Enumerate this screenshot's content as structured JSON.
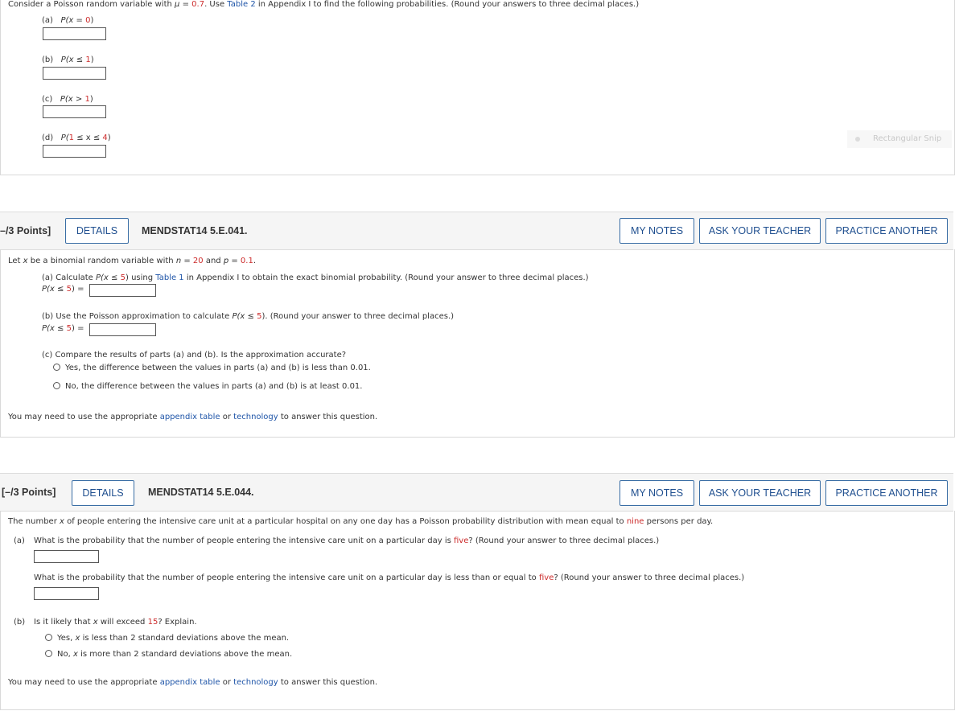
{
  "q1": {
    "intro": [
      "Consider a Poisson random variable with ",
      "μ",
      " = ",
      "0.7",
      ". Use ",
      "Table 2",
      " in Appendix I to find the following probabilities. (Round your answers to three decimal places.)"
    ],
    "parts": [
      {
        "tag": "(a)",
        "expr": [
          "P(x",
          " = ",
          "0",
          ")"
        ]
      },
      {
        "tag": "(b)",
        "expr": [
          "P(x",
          " ≤ ",
          "1",
          ")"
        ]
      },
      {
        "tag": "(c)",
        "expr": [
          "P(x",
          " > ",
          "1",
          ")"
        ]
      },
      {
        "tag": "(d)",
        "expr": [
          "P(",
          "1",
          " ≤ x ≤ ",
          "4",
          ")"
        ]
      }
    ]
  },
  "snip": {
    "label": "Rectangular Snip"
  },
  "q2": {
    "points": "–/3 Points]",
    "details": "DETAILS",
    "code": "MENDSTAT14 5.E.041.",
    "my_notes": "MY NOTES",
    "ask_teacher": "ASK YOUR TEACHER",
    "practice": "PRACTICE ANOTHER",
    "intro": [
      "Let ",
      "x",
      " be a binomial random variable with ",
      "n",
      " = ",
      "20",
      " and ",
      "p",
      " = ",
      "0.1",
      "."
    ],
    "a_text": [
      "(a) Calculate ",
      "P(x",
      " ≤ ",
      "5",
      ")",
      " using ",
      "Table 1",
      " in Appendix I to obtain the exact binomial probability. (Round your answer to three decimal places.)"
    ],
    "a_expr": [
      "P(x",
      " ≤ ",
      "5",
      ") ="
    ],
    "b_text": [
      "(b) Use the Poisson approximation to calculate ",
      "P(x",
      " ≤ ",
      "5",
      ")",
      ". (Round your answer to three decimal places.)"
    ],
    "b_expr": [
      "P(x",
      " ≤ ",
      "5",
      ") ="
    ],
    "c_text": "(c) Compare the results of parts (a) and (b). Is the approximation accurate?",
    "options": [
      "Yes, the difference between the values in parts (a) and (b) is less than 0.01.",
      "No, the difference between the values in parts (a) and (b) is at least 0.01."
    ],
    "footer": [
      "You may need to use the appropriate ",
      "appendix table",
      " or ",
      "technology",
      " to answer this question."
    ]
  },
  "q3": {
    "points": "[–/3 Points]",
    "details": "DETAILS",
    "code": "MENDSTAT14 5.E.044.",
    "my_notes": "MY NOTES",
    "ask_teacher": "ASK YOUR TEACHER",
    "practice": "PRACTICE ANOTHER",
    "intro": [
      "The number ",
      "x",
      " of people entering the intensive care unit at a particular hospital on any one day has a Poisson probability distribution with mean equal to ",
      "nine",
      " persons per day."
    ],
    "a_tag": "(a)",
    "a_text": [
      "What is the probability that the number of people entering the intensive care unit on a particular day is ",
      "five",
      "? (Round your answer to three decimal places.)"
    ],
    "a2_text": [
      "What is the probability that the number of people entering the intensive care unit on a particular day is less than or equal to ",
      "five",
      "? (Round your answer to three decimal places.)"
    ],
    "b_tag": "(b)",
    "b_text": [
      "Is it likely that ",
      "x",
      " will exceed ",
      "15",
      "? Explain."
    ],
    "options": [
      [
        "Yes, ",
        "x",
        " is less than 2 standard deviations above the mean."
      ],
      [
        "No, ",
        "x",
        " is more than 2 standard deviations above the mean."
      ]
    ],
    "footer": [
      "You may need to use the appropriate ",
      "appendix table",
      " or ",
      "technology",
      " to answer this question."
    ]
  }
}
